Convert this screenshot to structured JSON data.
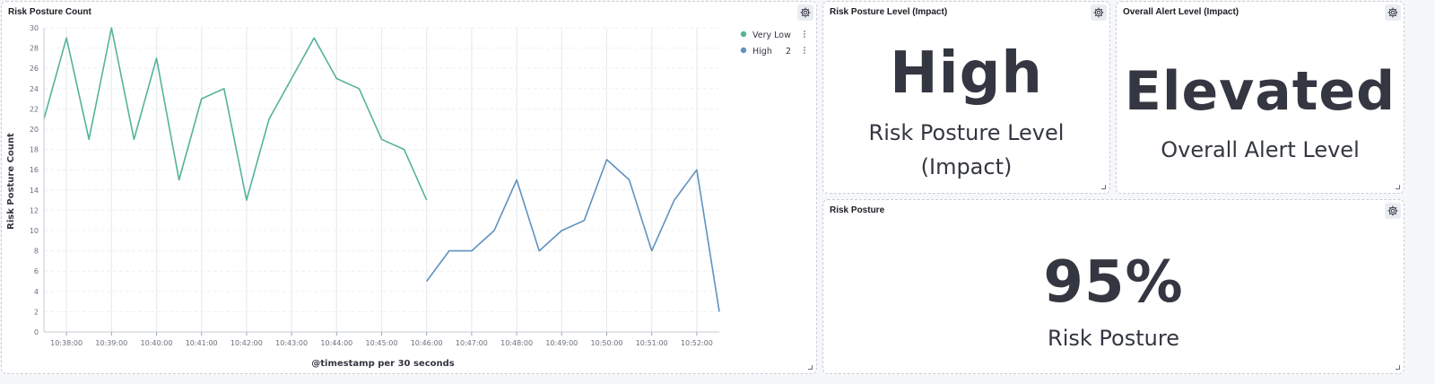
{
  "panels": {
    "chart": {
      "title": "Risk Posture Count"
    },
    "risk_level": {
      "title": "Risk Posture Level (Impact)",
      "value": "High",
      "label_line1": "Risk Posture Level",
      "label_line2": "(Impact)"
    },
    "alert_level": {
      "title": "Overall Alert Level (Impact)",
      "value": "Elevated",
      "label": "Overall Alert Level"
    },
    "posture": {
      "title": "Risk Posture",
      "value": "95%",
      "label": "Risk Posture"
    }
  },
  "icons": {
    "settings": "gear-icon",
    "resize": "resize-handle-icon",
    "legend_options": "vertical-dots-icon"
  },
  "chart_data": {
    "type": "line",
    "title": "Risk Posture Count",
    "xlabel": "@timestamp per 30 seconds",
    "ylabel": "Risk Posture Count",
    "ylim": [
      0,
      30
    ],
    "yticks": [
      0,
      2,
      4,
      6,
      8,
      10,
      12,
      14,
      16,
      18,
      20,
      22,
      24,
      26,
      28,
      30
    ],
    "xticks": [
      "10:38:00",
      "10:39:00",
      "10:40:00",
      "10:41:00",
      "10:42:00",
      "10:43:00",
      "10:44:00",
      "10:45:00",
      "10:46:00",
      "10:47:00",
      "10:48:00",
      "10:49:00",
      "10:50:00",
      "10:51:00",
      "10:52:00"
    ],
    "x_range": [
      "10:37:30",
      "10:52:30"
    ],
    "grid": true,
    "legend_position": "top-right",
    "legend": [
      {
        "name": "Very Low",
        "value": ""
      },
      {
        "name": "High",
        "value": "2"
      }
    ],
    "series": [
      {
        "name": "Very Low",
        "color": "#54b399",
        "points": [
          {
            "x": "10:37:30",
            "y": 21
          },
          {
            "x": "10:38:00",
            "y": 29
          },
          {
            "x": "10:38:30",
            "y": 19
          },
          {
            "x": "10:39:00",
            "y": 30
          },
          {
            "x": "10:39:30",
            "y": 19
          },
          {
            "x": "10:40:00",
            "y": 27
          },
          {
            "x": "10:40:30",
            "y": 15
          },
          {
            "x": "10:41:00",
            "y": 23
          },
          {
            "x": "10:41:30",
            "y": 24
          },
          {
            "x": "10:42:00",
            "y": 13
          },
          {
            "x": "10:42:30",
            "y": 21
          },
          {
            "x": "10:43:00",
            "y": 25
          },
          {
            "x": "10:43:30",
            "y": 29
          },
          {
            "x": "10:44:00",
            "y": 25
          },
          {
            "x": "10:44:30",
            "y": 24
          },
          {
            "x": "10:45:00",
            "y": 19
          },
          {
            "x": "10:45:30",
            "y": 18
          },
          {
            "x": "10:46:00",
            "y": 13
          }
        ]
      },
      {
        "name": "High",
        "color": "#6092c0",
        "points": [
          {
            "x": "10:46:00",
            "y": 5
          },
          {
            "x": "10:46:30",
            "y": 8
          },
          {
            "x": "10:47:00",
            "y": 8
          },
          {
            "x": "10:47:30",
            "y": 10
          },
          {
            "x": "10:48:00",
            "y": 15
          },
          {
            "x": "10:48:30",
            "y": 8
          },
          {
            "x": "10:49:00",
            "y": 10
          },
          {
            "x": "10:49:30",
            "y": 11
          },
          {
            "x": "10:50:00",
            "y": 17
          },
          {
            "x": "10:50:30",
            "y": 15
          },
          {
            "x": "10:51:00",
            "y": 8
          },
          {
            "x": "10:51:30",
            "y": 13
          },
          {
            "x": "10:52:00",
            "y": 16
          },
          {
            "x": "10:52:30",
            "y": 2
          }
        ]
      }
    ]
  }
}
